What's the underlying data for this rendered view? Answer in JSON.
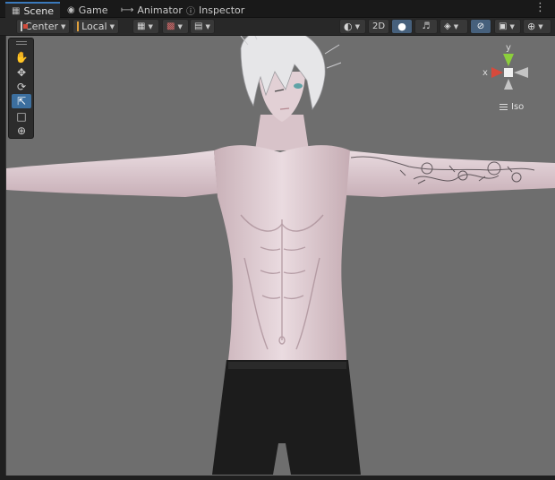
{
  "tabs": [
    {
      "label": "Scene",
      "icon": "grid-icon",
      "active": true
    },
    {
      "label": "Game",
      "icon": "gamepad-icon",
      "active": false
    },
    {
      "label": "Animator",
      "icon": "animator-icon",
      "active": false
    },
    {
      "label": "Inspector",
      "icon": "info-icon",
      "active": false
    }
  ],
  "toolbar": {
    "pivot_mode": "Center",
    "pivot_rotation": "Local",
    "mode_2d": "2D"
  },
  "tools": [
    "hand-tool",
    "move-tool",
    "rotate-tool",
    "scale-tool",
    "rect-tool",
    "transform-tool"
  ],
  "gizmo": {
    "y_label": "y",
    "x_label": "x",
    "projection": "Iso"
  },
  "colors": {
    "accent": "#3a79bb",
    "viewport_bg": "#6e6e6e",
    "x_axis": "#d64a3c",
    "y_axis": "#8ccf3c",
    "skin": "#e2cdd2",
    "shorts": "#1c1c1c",
    "hair": "#e8e8ea"
  }
}
